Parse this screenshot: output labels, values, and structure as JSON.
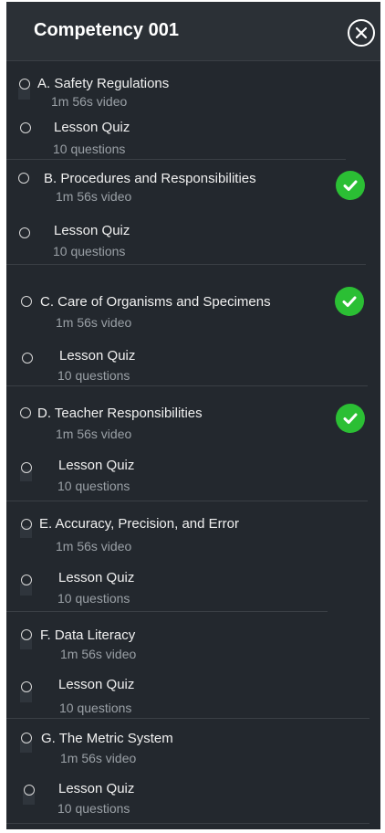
{
  "header": {
    "title": "Competency 001",
    "close_icon": "close-icon"
  },
  "colors": {
    "panel": "#23282e",
    "check": "#2bbf34",
    "text": "#f0f0f0",
    "subtext": "#9aa0a6"
  },
  "sections": [
    {
      "lesson": "A. Safety Regulations",
      "lesson_meta": "1m 56s video",
      "quiz": "Lesson Quiz",
      "quiz_meta": "10 questions",
      "completed": false
    },
    {
      "lesson": "B. Procedures and Responsibilities",
      "lesson_meta": "1m 56s video",
      "quiz": "Lesson Quiz",
      "quiz_meta": "10 questions",
      "completed": true
    },
    {
      "lesson": "C. Care of Organisms and Specimens",
      "lesson_meta": "1m 56s video",
      "quiz": "Lesson Quiz",
      "quiz_meta": "10 questions",
      "completed": true
    },
    {
      "lesson": "D. Teacher Responsibilities",
      "lesson_meta": "1m 56s video",
      "quiz": "Lesson Quiz",
      "quiz_meta": "10 questions",
      "completed": true
    },
    {
      "lesson": "E. Accuracy, Precision, and Error",
      "lesson_meta": "1m 56s video",
      "quiz": "Lesson Quiz",
      "quiz_meta": "10 questions",
      "completed": false
    },
    {
      "lesson": "F. Data Literacy",
      "lesson_meta": "1m 56s video",
      "quiz": "Lesson Quiz",
      "quiz_meta": "10 questions",
      "completed": false
    },
    {
      "lesson": "G. The Metric System",
      "lesson_meta": "1m 56s video",
      "quiz": "Lesson Quiz",
      "quiz_meta": "10 questions",
      "completed": false
    }
  ]
}
